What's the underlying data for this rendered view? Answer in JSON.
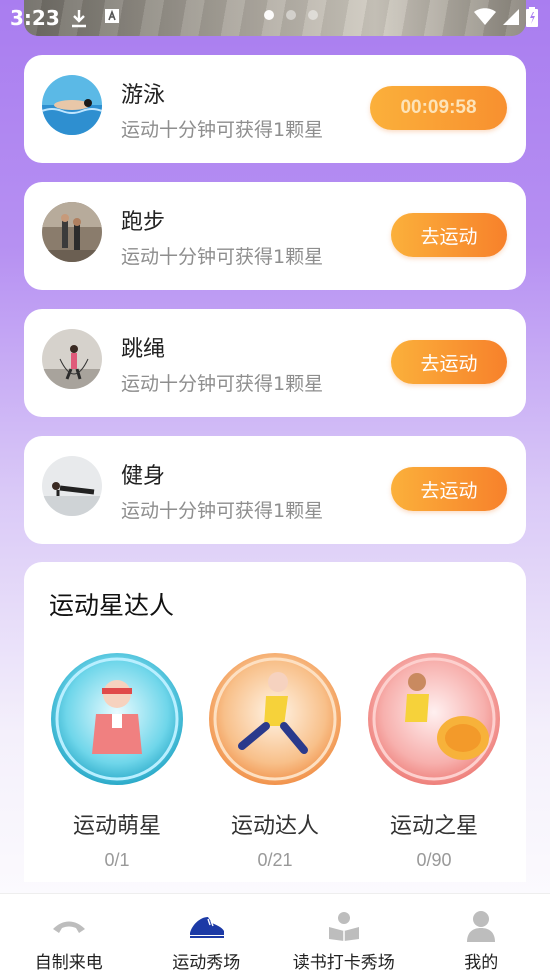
{
  "status_bar": {
    "time": "3:23"
  },
  "banner": {
    "dots_count": 3,
    "active_dot": 0
  },
  "activities": [
    {
      "title": "游泳",
      "subtitle": "运动十分钟可获得1颗星",
      "button": "00:09:58",
      "state": "timer",
      "icon": "swimming-photo"
    },
    {
      "title": "跑步",
      "subtitle": "运动十分钟可获得1颗星",
      "button": "去运动",
      "state": "idle",
      "icon": "running-photo"
    },
    {
      "title": "跳绳",
      "subtitle": "运动十分钟可获得1颗星",
      "button": "去运动",
      "state": "idle",
      "icon": "jump-rope-photo"
    },
    {
      "title": "健身",
      "subtitle": "运动十分钟可获得1颗星",
      "button": "去运动",
      "state": "idle",
      "icon": "fitness-photo"
    }
  ],
  "star_panel": {
    "title": "运动星达人",
    "badges": [
      {
        "name": "运动萌星",
        "count": "0/1",
        "color": "#4dc6e0"
      },
      {
        "name": "运动达人",
        "count": "0/21",
        "color": "#f4a86a"
      },
      {
        "name": "运动之星",
        "count": "0/90",
        "color": "#f59a9a"
      }
    ]
  },
  "tabbar": {
    "tabs": [
      {
        "label": "自制来电",
        "icon": "phone-icon",
        "active": false
      },
      {
        "label": "运动秀场",
        "icon": "sneaker-icon",
        "active": true
      },
      {
        "label": "读书打卡秀场",
        "icon": "book-reader-icon",
        "active": false
      },
      {
        "label": "我的",
        "icon": "person-icon",
        "active": false
      }
    ]
  },
  "colors": {
    "accent": "#f7812b",
    "active_tab": "#1c3aa6",
    "inactive_tab": "#bdbdbd"
  }
}
